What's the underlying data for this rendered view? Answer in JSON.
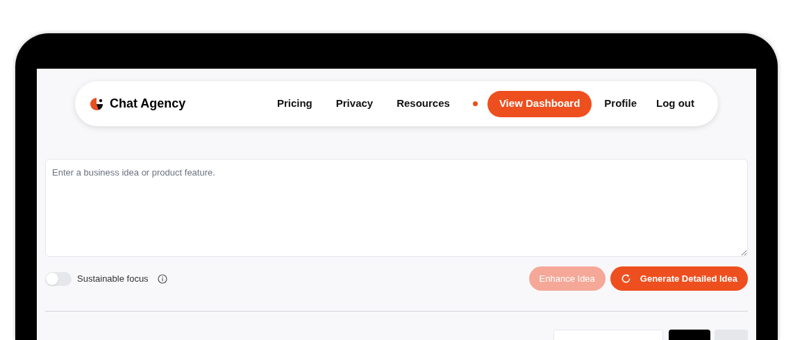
{
  "nav": {
    "brand": "Chat Agency",
    "links": [
      "Pricing",
      "Privacy",
      "Resources"
    ],
    "notification_dot": true,
    "cta": "View Dashboard",
    "account_links": [
      "Profile",
      "Log out"
    ]
  },
  "idea_input": {
    "placeholder": "Enter a business idea or product feature."
  },
  "options": {
    "toggle_label": "Sustainable focus",
    "toggle_on": false
  },
  "actions": [
    {
      "label": "Enhance Idea",
      "disabled": true,
      "kind": "plain"
    },
    {
      "label": "Generate Detailed Idea",
      "disabled": false,
      "kind": "refresh"
    }
  ]
}
